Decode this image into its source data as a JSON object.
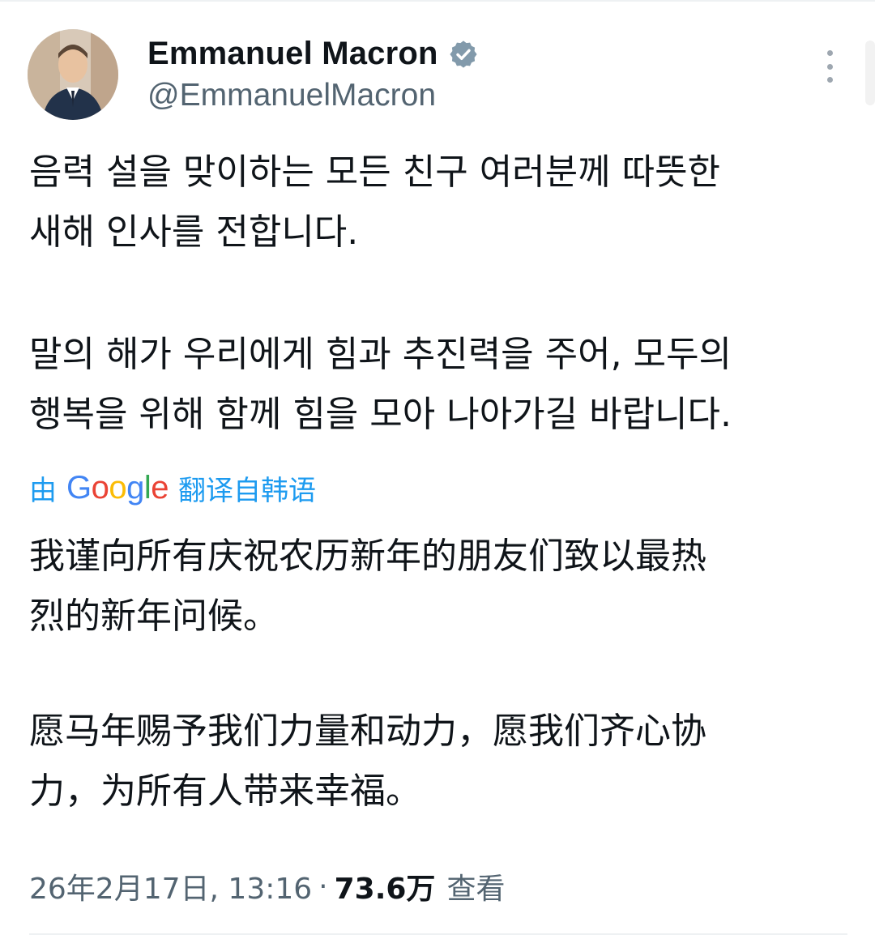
{
  "author": {
    "display_name": "Emmanuel Macron",
    "handle": "@EmmanuelMacron",
    "verified_icon": "verified-badge-icon",
    "verified_color": "#829aab"
  },
  "tweet": {
    "paragraph_1": "음력 설을 맞이하는 모든 친구 여러분께 따뜻한\n새해 인사를 전합니다.",
    "paragraph_2": "말의 해가 우리에게 힘과 추진력을 주어, 모두의\n행복을 위해 함께 힘을 모아 나아가길 바랍니다."
  },
  "translation": {
    "prefix": "由",
    "google": "Google",
    "suffix": "翻译自韩语",
    "link_color": "#1d9bf0",
    "paragraph_1": "我谨向所有庆祝农历新年的朋友们致以最热\n烈的新年问候。",
    "paragraph_2": "愿马年赐予我们力量和动力，愿我们齐心协\n力，为所有人带来幸福。"
  },
  "meta": {
    "timestamp": "26年2月17日, 13:16",
    "separator": "·",
    "views_count": "73.6万",
    "views_label": "查看"
  },
  "icons": {
    "more": "more-vertical-icon",
    "avatar": "avatar-photo"
  }
}
